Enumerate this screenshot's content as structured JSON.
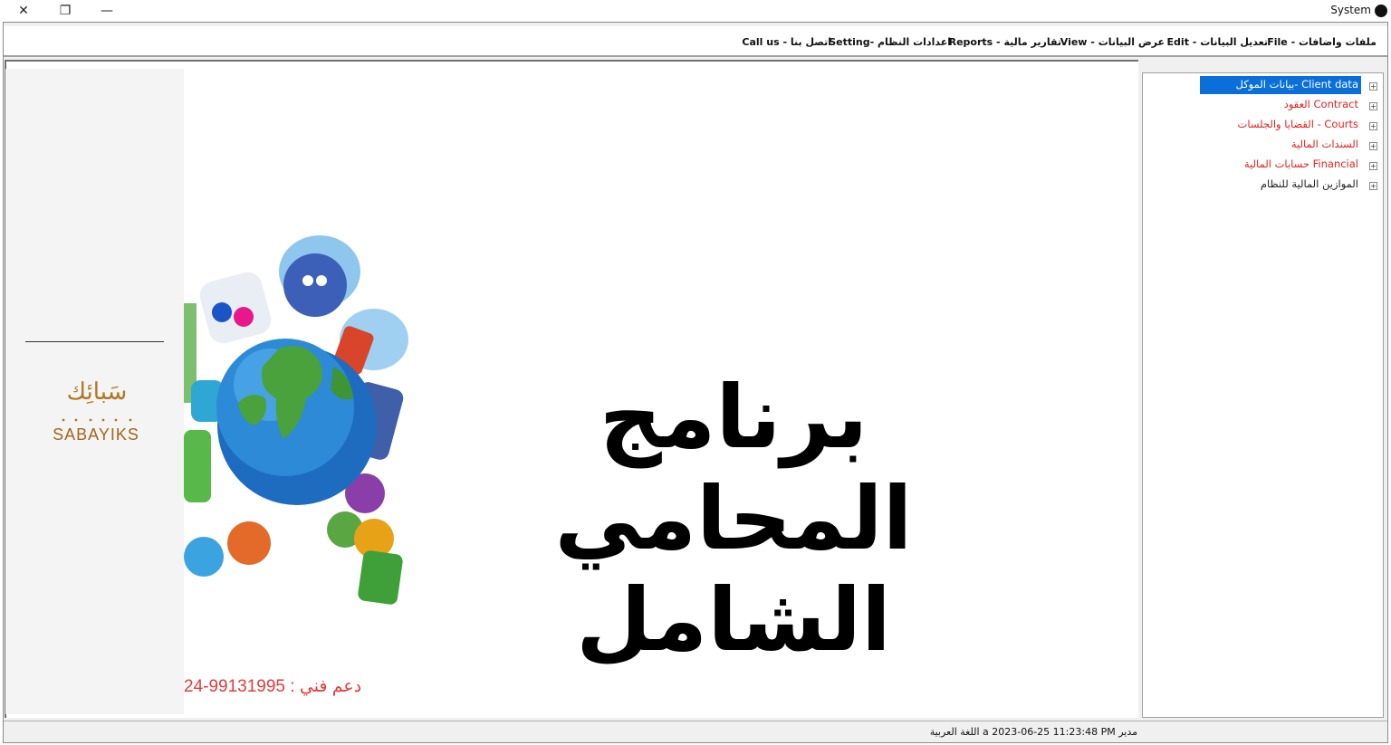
{
  "window": {
    "title": "System",
    "close_glyph": "✕",
    "restore_glyph": "❐",
    "minimize_glyph": "—"
  },
  "menu": [
    {
      "label": "File - ملفات واضافات"
    },
    {
      "label": "Edit - تعديل البيانات"
    },
    {
      "label": "View - عرض البيانات"
    },
    {
      "label": "Reports - تقارير مالية"
    },
    {
      "label": "Setting- اعدادات النظام"
    },
    {
      "label": "Call us - اتصل بنا"
    }
  ],
  "tree": {
    "items": [
      {
        "label": "Client data -بيانات الموكل",
        "selected": true,
        "color": "#ffffff"
      },
      {
        "label": "Contract    العقود",
        "color": "#e62020"
      },
      {
        "label": "Courts - القضايا والجلسات",
        "color": "#e62020"
      },
      {
        "label": "السندات المالية",
        "color": "#e62020"
      },
      {
        "label": "Financial   حسابات المالية",
        "color": "#e62020"
      },
      {
        "label": "الموازين المالية للنظام",
        "color": "#222222"
      }
    ],
    "expander_glyph": "+"
  },
  "banner": {
    "title": "برنامج المحامي الشامل",
    "logo_ar": "سَبائِك",
    "logo_en": "SABAYIKS",
    "support": "دعم فني : 99131995-24"
  },
  "status": {
    "text": "مدير  a   2023-06-25 11:23:48 PM  اللغة العربية"
  },
  "colors": {
    "selection": "#0a6fd8",
    "red_text": "#e62020",
    "logo_gold": "#b07820"
  }
}
